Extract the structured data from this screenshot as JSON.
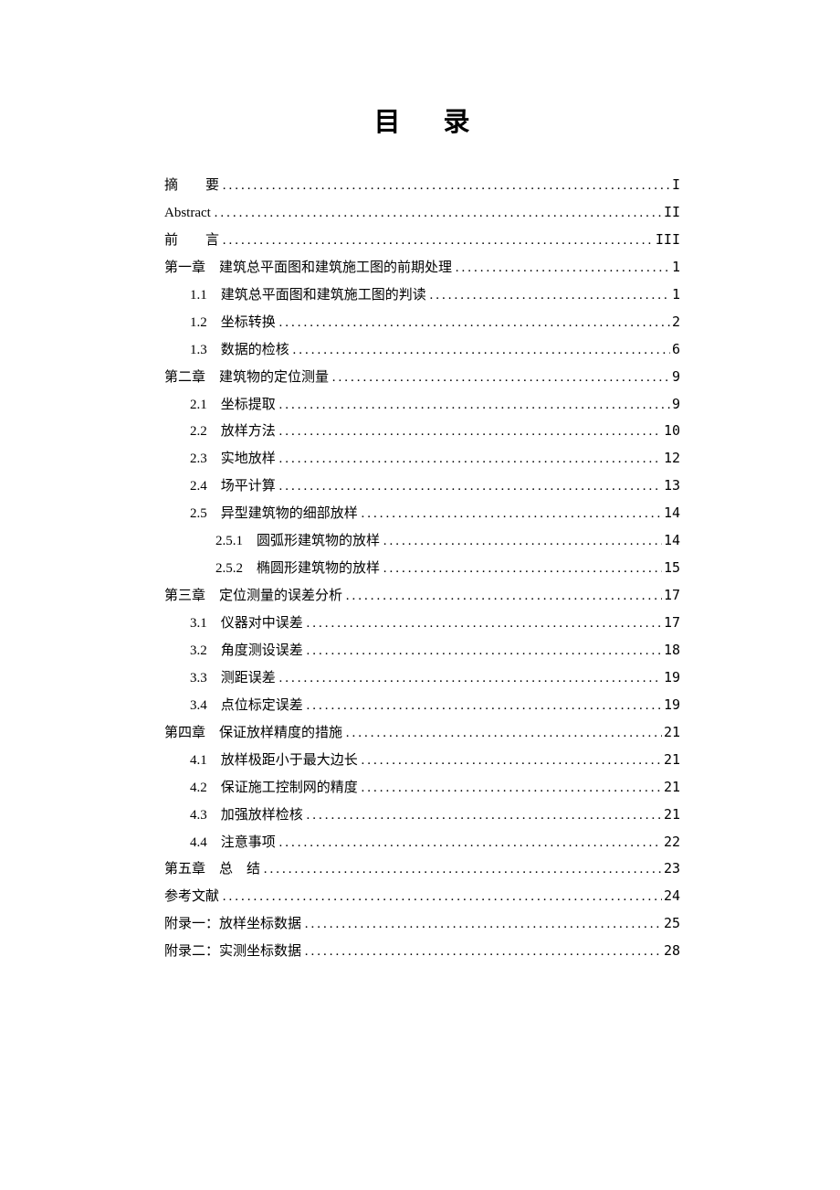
{
  "title_part1": "目",
  "title_part2": "录",
  "toc": [
    {
      "level": 0,
      "label": "摘  要",
      "page": "I"
    },
    {
      "level": 0,
      "label": "Abstract",
      "page": "II"
    },
    {
      "level": 0,
      "label": "前  言",
      "page": "III"
    },
    {
      "level": 0,
      "label": "第一章 建筑总平面图和建筑施工图的前期处理",
      "page": "1"
    },
    {
      "level": 1,
      "label": "1.1 建筑总平面图和建筑施工图的判读",
      "page": "1"
    },
    {
      "level": 1,
      "label": "1.2 坐标转换",
      "page": "2"
    },
    {
      "level": 1,
      "label": "1.3 数据的检核",
      "page": "6"
    },
    {
      "level": 0,
      "label": "第二章 建筑物的定位测量",
      "page": "9"
    },
    {
      "level": 1,
      "label": "2.1 坐标提取",
      "page": "9"
    },
    {
      "level": 1,
      "label": "2.2 放样方法",
      "page": "10"
    },
    {
      "level": 1,
      "label": "2.3 实地放样",
      "page": "12"
    },
    {
      "level": 1,
      "label": "2.4 场平计算",
      "page": "13"
    },
    {
      "level": 1,
      "label": "2.5 异型建筑物的细部放样",
      "page": "14"
    },
    {
      "level": 2,
      "label": "2.5.1 圆弧形建筑物的放样",
      "page": "14"
    },
    {
      "level": 2,
      "label": "2.5.2 椭圆形建筑物的放样",
      "page": "15"
    },
    {
      "level": 0,
      "label": "第三章 定位测量的误差分析",
      "page": "17"
    },
    {
      "level": 1,
      "label": "3.1 仪器对中误差",
      "page": "17"
    },
    {
      "level": 1,
      "label": "3.2 角度测设误差",
      "page": "18"
    },
    {
      "level": 1,
      "label": "3.3 测距误差",
      "page": "19"
    },
    {
      "level": 1,
      "label": "3.4 点位标定误差",
      "page": "19"
    },
    {
      "level": 0,
      "label": "第四章 保证放样精度的措施",
      "page": "21"
    },
    {
      "level": 1,
      "label": "4.1 放样极距小于最大边长",
      "page": "21"
    },
    {
      "level": 1,
      "label": "4.2 保证施工控制网的精度",
      "page": "21"
    },
    {
      "level": 1,
      "label": "4.3 加强放样检核",
      "page": "21"
    },
    {
      "level": 1,
      "label": "4.4 注意事项",
      "page": "22"
    },
    {
      "level": 0,
      "label": "第五章 总 结",
      "page": "23"
    },
    {
      "level": 0,
      "label": "参考文献",
      "page": "24"
    },
    {
      "level": 0,
      "label": "附录一：放样坐标数据",
      "page": "25"
    },
    {
      "level": 0,
      "label": "附录二：实测坐标数据",
      "page": "28"
    }
  ]
}
